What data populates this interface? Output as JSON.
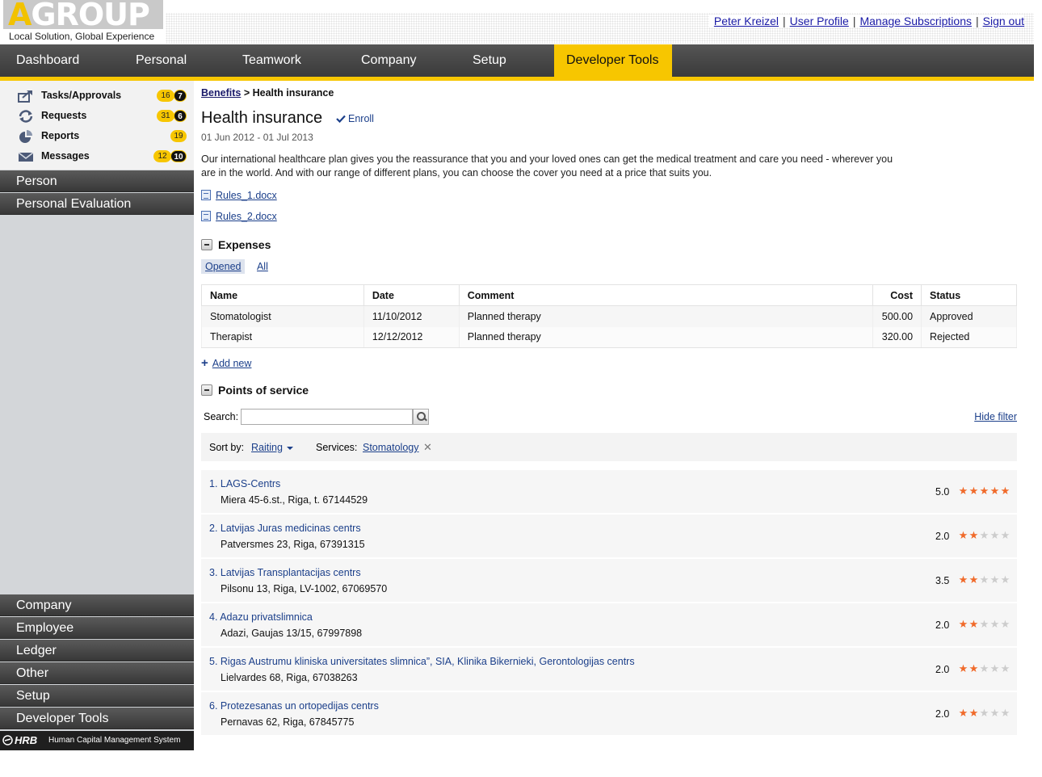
{
  "logo": {
    "text_first": "A",
    "text_rest": "GROUP",
    "tagline": "Local Solution, Global Experience"
  },
  "user_links": [
    "Peter Kreizel",
    "User Profile",
    "Manage Subscriptions",
    "Sign out"
  ],
  "main_nav": [
    "Dashboard",
    "Personal",
    "Teamwork",
    "Company",
    "Setup",
    "Developer Tools"
  ],
  "main_nav_active": "Developer Tools",
  "colors": {
    "accent": "#f7c600",
    "nav_dark": "#3a3a3a",
    "link": "#1b3f8a",
    "approved": "#3a8a1f",
    "rejected": "#d32020",
    "star": "#f06a2a"
  },
  "sidebar": {
    "quick": [
      {
        "label": "Tasks/Approvals",
        "icon": "share-arrow-icon",
        "count_a": "16",
        "count_b": "7"
      },
      {
        "label": "Requests",
        "icon": "refresh-icon",
        "count_a": "31",
        "count_b": "6"
      },
      {
        "label": "Reports",
        "icon": "pie-chart-icon",
        "count_a": "19",
        "count_b": ""
      },
      {
        "label": "Messages",
        "icon": "envelope-icon",
        "count_a": "12",
        "count_b": "10"
      }
    ],
    "sections_top": [
      "Person",
      "Personal Evaluation"
    ],
    "sections_bottom": [
      "Company",
      "Employee",
      "Ledger",
      "Other",
      "Setup",
      "Developer Tools"
    ],
    "footer_brand": "HRB",
    "footer_system": "Human Capital Management System"
  },
  "breadcrumb": {
    "parent": "Benefits",
    "separator": ">",
    "current": "Health insurance"
  },
  "page": {
    "title": "Health insurance",
    "enroll_label": "Enroll",
    "dates": "01 Jun 2012 - 01 Jul 2013",
    "description": "Our international healthcare plan gives you the reassurance that you and your loved ones can get the medical treatment and care you need - wherever you are in the world. And with our range of different plans, you can choose the cover you need at a price that suits you.",
    "documents": [
      "Rules_1.docx",
      "Rules_2.docx"
    ]
  },
  "expenses": {
    "title": "Expenses",
    "tabs": [
      "Opened",
      "All"
    ],
    "active_tab": "Opened",
    "columns": [
      "Name",
      "Date",
      "Comment",
      "Cost",
      "Status"
    ],
    "rows": [
      {
        "name": "Stomatologist",
        "date": "11/10/2012",
        "comment": "Planned therapy",
        "cost": "500.00",
        "status": "Approved"
      },
      {
        "name": "Therapist",
        "date": "12/12/2012",
        "comment": "Planned therapy",
        "cost": "320.00",
        "status": "Rejected"
      }
    ],
    "add_new": "Add new"
  },
  "points_of_service": {
    "title": "Points of service",
    "search_label": "Search:",
    "search_value": "",
    "hide_filter": "Hide filter",
    "sort_label": "Sort by:",
    "sort_value": "Raiting",
    "services_label": "Services:",
    "services_value": "Stomatology",
    "items": [
      {
        "name": "1. LAGS-Centrs",
        "address": "Miera 45-6.st., Riga, t. 67144529",
        "rating": "5.0",
        "stars": 5
      },
      {
        "name": "2. Latvijas Juras medicinas centrs",
        "address": "Patversmes 23, Riga, 67391315",
        "rating": "2.0",
        "stars": 2
      },
      {
        "name": "3. Latvijas Transplantacijas centrs",
        "address": "Pilsonu 13, Riga, LV-1002, 67069570",
        "rating": "3.5",
        "stars": 2
      },
      {
        "name": "4. Adazu privatslimnica",
        "address": "Adazi, Gaujas 13/15, 67997898",
        "rating": "2.0",
        "stars": 2
      },
      {
        "name": "5. Rigas Austrumu kliniska universitates slimnica”, SIA, Klinika Bikernieki, Gerontologijas centrs",
        "address": "Lielvardes 68, Riga, 67038263",
        "rating": "2.0",
        "stars": 2
      },
      {
        "name": "6. Protezesanas un ortopedijas centrs",
        "address": "Pernavas 62, Riga, 67845775",
        "rating": "2.0",
        "stars": 2
      }
    ]
  }
}
